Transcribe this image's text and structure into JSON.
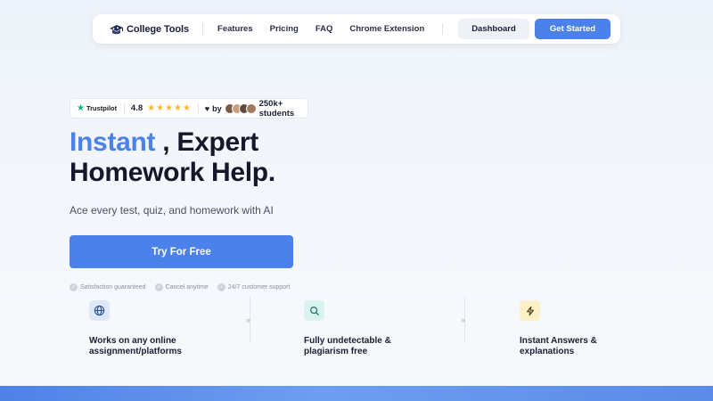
{
  "nav": {
    "brand": "College Tools",
    "links": [
      "Features",
      "Pricing",
      "FAQ",
      "Chrome Extension"
    ],
    "dashboard": "Dashboard",
    "get_started": "Get Started"
  },
  "trust": {
    "platform": "Trustpilot",
    "rating": "4.8",
    "stars": 5,
    "by": "by",
    "students": "250k+ students"
  },
  "hero": {
    "headline_accent": "Instant",
    "headline_rest": " , Expert",
    "headline_line2": "Homework Help.",
    "subtitle": "Ace every test, quiz, and homework with AI",
    "cta": "Try For Free"
  },
  "guarantees": [
    "Satisfaction guaranteed",
    "Cancel anytime",
    "24/7 customer support"
  ],
  "features": [
    {
      "icon": "globe-icon",
      "line1": "Works on any online",
      "line2": "assignment/platforms"
    },
    {
      "icon": "search-icon",
      "line1": "Fully undetectable &",
      "line2": "plagiarism free"
    },
    {
      "icon": "lightning-icon",
      "line1": "Instant Answers &",
      "line2": "explanations"
    }
  ],
  "colors": {
    "primary": "#4b82ea",
    "text": "#14182a",
    "trustpilot": "#00b67a",
    "star": "#f7b928"
  }
}
